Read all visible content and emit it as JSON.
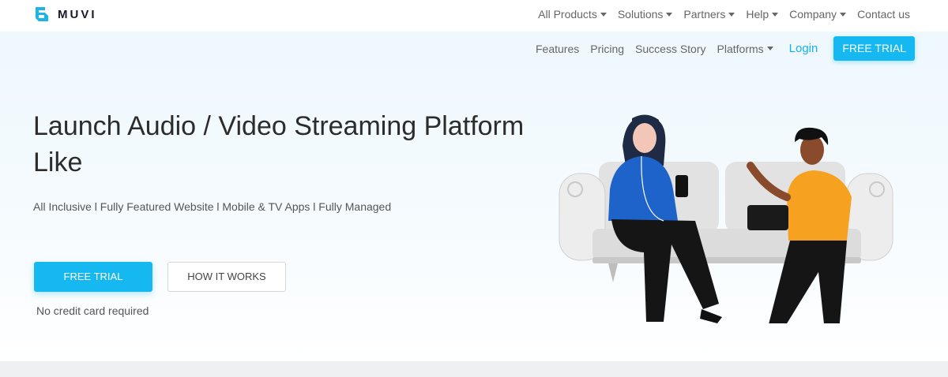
{
  "brand": {
    "name": "MUVI"
  },
  "topnav": [
    {
      "label": "All Products",
      "dropdown": true
    },
    {
      "label": "Solutions",
      "dropdown": true
    },
    {
      "label": "Partners",
      "dropdown": true
    },
    {
      "label": "Help",
      "dropdown": true
    },
    {
      "label": "Company",
      "dropdown": true
    },
    {
      "label": "Contact us",
      "dropdown": false
    }
  ],
  "subnav": {
    "items": [
      {
        "label": "Features",
        "dropdown": false
      },
      {
        "label": "Pricing",
        "dropdown": false
      },
      {
        "label": "Success Story",
        "dropdown": false
      },
      {
        "label": "Platforms",
        "dropdown": true
      }
    ],
    "login": "Login",
    "free_trial": "FREE TRIAL"
  },
  "hero": {
    "headline": "Launch Audio / Video Streaming Platform Like",
    "tagline": "All Inclusive l Fully Featured Website l Mobile & TV Apps l Fully Managed",
    "primary_cta": "FREE TRIAL",
    "secondary_cta": "HOW IT WORKS",
    "note": "No credit card required"
  },
  "colors": {
    "accent": "#15b8f0",
    "text_dark": "#2c2c2c",
    "text_muted": "#666666"
  }
}
